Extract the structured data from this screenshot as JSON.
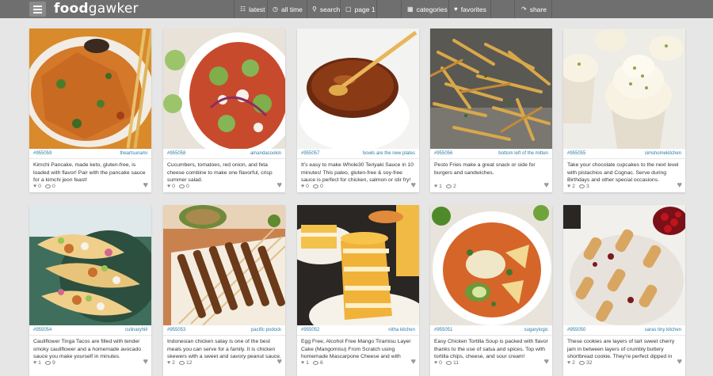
{
  "header": {
    "logo_part1": "food",
    "logo_part2": "gawker",
    "nav": {
      "latest": "latest",
      "all_time": "all time",
      "search": "search",
      "page": "page 1",
      "categories": "categories",
      "favorites": "favorites",
      "share": "share"
    }
  },
  "cards": [
    {
      "id": "#955059",
      "site": "theartsunami",
      "desc": "Kimchi Pancake, made keto, gluten-free, is loaded with flavor! Pair with the pancake sauce for a kimchi jeon feast!",
      "likes": "0",
      "comments": "0"
    },
    {
      "id": "#955058",
      "site": "amandacookin",
      "desc": "Cucumbers, tomatoes, red onion, and feta cheese combine to make one flavorful, crisp summer salad.",
      "likes": "0",
      "comments": "0"
    },
    {
      "id": "#955057",
      "site": "bowls are the new plates",
      "desc": "It's easy to make Whole30 Teriyaki Sauce in 10 minutes! This paleo, gluten-free & soy-free sauce is perfect for chicken, salmon or stir fry!",
      "likes": "0",
      "comments": "0"
    },
    {
      "id": "#955056",
      "site": "bottom left of the mitten",
      "desc": "Pesto Fries make a great snack or side for burgers and sandwiches.",
      "likes": "1",
      "comments": "2"
    },
    {
      "id": "#955055",
      "site": "simshomekitchen",
      "desc": "Take your chocolate cupcakes to the next level with pistachios and Cognac. Serve during Birthdays and other special occasions.",
      "likes": "2",
      "comments": "3"
    },
    {
      "id": "#955054",
      "site": "culinaryhill",
      "desc": "Cauliflower Tinga Tacos are filled with tender smoky cauliflower and a homemade avocado sauce you make yourself in minutes.",
      "likes": "1",
      "comments": "9"
    },
    {
      "id": "#955053",
      "site": "pacific podock",
      "desc": "Indonesian chicken satay is one of the best meals you can serve for a family. It is chicken skewers with a sweet and savory peanut sauce.",
      "likes": "2",
      "comments": "12"
    },
    {
      "id": "#955052",
      "site": "nitha kitchen",
      "desc": "Egg Free, Alcohol Free Mango Tiramisu Layer Cake (Mangomisu) From Scratch using homemade Mascarpone Cheese and with",
      "likes": "1",
      "comments": "6"
    },
    {
      "id": "#955051",
      "site": "sugarylogic",
      "desc": "Easy Chicken Tortilla Soup is packed with flavor thanks to the use of salsa and spices. Top with tortilla chips, cheese, and sour cream!",
      "likes": "0",
      "comments": "11"
    },
    {
      "id": "#955050",
      "site": "saras tiny kitchen",
      "desc": "These cookies are layers of tart sweet cherry jam in between layers of crumbly buttery shortbread cookie. They're perfect dipped in",
      "likes": "2",
      "comments": "32"
    }
  ],
  "colors": {
    "topbar": "#6f6f6f",
    "background": "#e6e6e6",
    "link": "#2b7ea8"
  },
  "icons": [
    "menu-icon",
    "latest-icon",
    "clock-icon",
    "search-icon",
    "page-icon",
    "categories-icon",
    "heart-icon",
    "share-icon",
    "comment-icon"
  ]
}
